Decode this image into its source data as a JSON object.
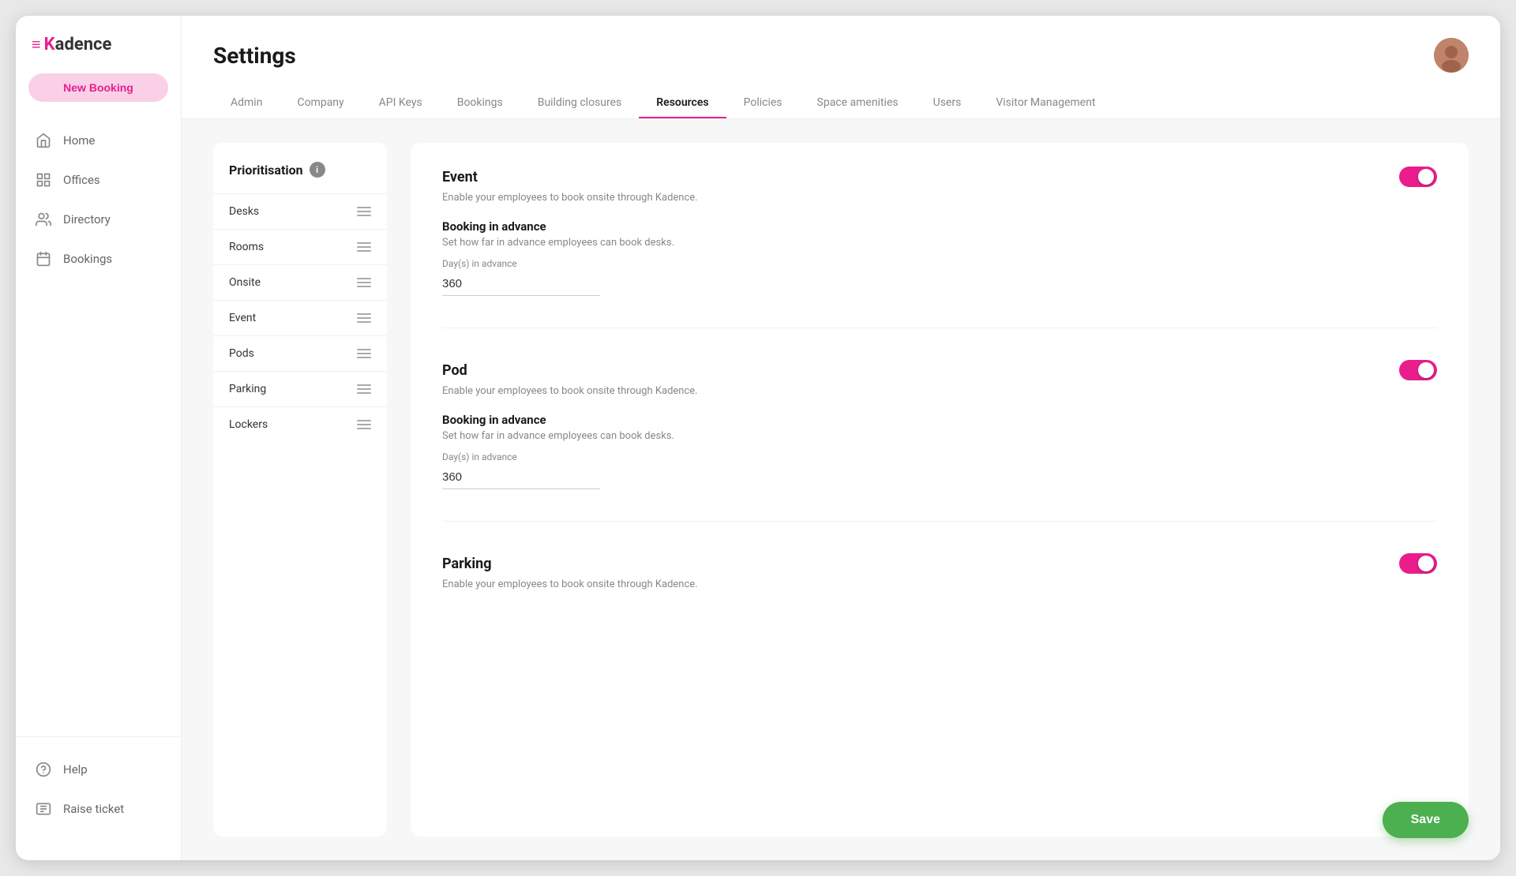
{
  "app": {
    "logo_icon": "≡",
    "logo_prefix": "K",
    "logo_suffix": "adence"
  },
  "sidebar": {
    "new_booking_label": "New Booking",
    "nav_items": [
      {
        "id": "home",
        "label": "Home",
        "icon": "home"
      },
      {
        "id": "offices",
        "label": "Offices",
        "icon": "offices"
      },
      {
        "id": "directory",
        "label": "Directory",
        "icon": "directory"
      },
      {
        "id": "bookings",
        "label": "Bookings",
        "icon": "bookings"
      }
    ],
    "bottom_items": [
      {
        "id": "help",
        "label": "Help",
        "icon": "help"
      },
      {
        "id": "raise-ticket",
        "label": "Raise ticket",
        "icon": "ticket"
      }
    ]
  },
  "header": {
    "page_title": "Settings",
    "tabs": [
      {
        "id": "admin",
        "label": "Admin",
        "active": false
      },
      {
        "id": "company",
        "label": "Company",
        "active": false
      },
      {
        "id": "api-keys",
        "label": "API Keys",
        "active": false
      },
      {
        "id": "bookings",
        "label": "Bookings",
        "active": false
      },
      {
        "id": "building-closures",
        "label": "Building closures",
        "active": false
      },
      {
        "id": "resources",
        "label": "Resources",
        "active": true
      },
      {
        "id": "policies",
        "label": "Policies",
        "active": false
      },
      {
        "id": "space-amenities",
        "label": "Space amenities",
        "active": false
      },
      {
        "id": "users",
        "label": "Users",
        "active": false
      },
      {
        "id": "visitor-management",
        "label": "Visitor Management",
        "active": false
      }
    ]
  },
  "prioritisation": {
    "title": "Prioritisation",
    "items": [
      {
        "id": "desks",
        "label": "Desks"
      },
      {
        "id": "rooms",
        "label": "Rooms"
      },
      {
        "id": "onsite",
        "label": "Onsite"
      },
      {
        "id": "event",
        "label": "Event"
      },
      {
        "id": "pods",
        "label": "Pods"
      },
      {
        "id": "parking",
        "label": "Parking"
      },
      {
        "id": "lockers",
        "label": "Lockers"
      }
    ]
  },
  "resources": [
    {
      "id": "event",
      "name": "Event",
      "description": "Enable your employees to book onsite through Kadence.",
      "enabled": true,
      "booking_advance": {
        "title": "Booking in advance",
        "description": "Set how far in advance employees can book desks.",
        "days_label": "Day(s) in advance",
        "days_value": "360"
      }
    },
    {
      "id": "pod",
      "name": "Pod",
      "description": "Enable your employees to book onsite through Kadence.",
      "enabled": true,
      "booking_advance": {
        "title": "Booking in advance",
        "description": "Set how far in advance employees can book desks.",
        "days_label": "Day(s) in advance",
        "days_value": "360"
      }
    },
    {
      "id": "parking",
      "name": "Parking",
      "description": "Enable your employees to book onsite through Kadence.",
      "enabled": true,
      "booking_advance": null
    }
  ],
  "save_button": {
    "label": "Save"
  }
}
